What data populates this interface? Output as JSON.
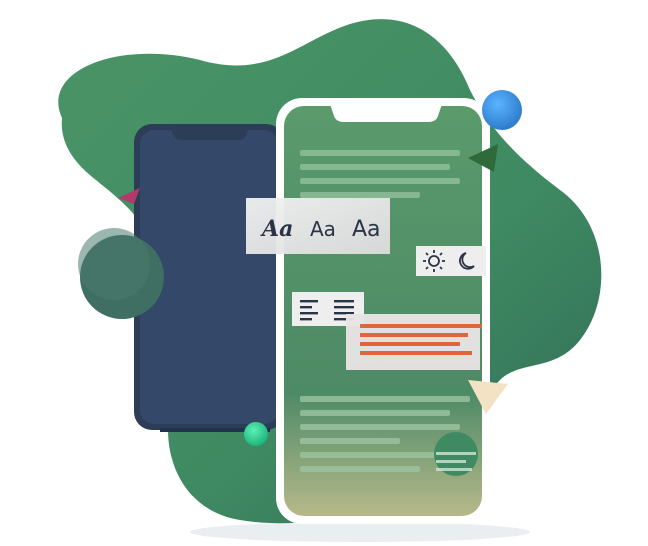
{
  "illustration": {
    "description_free": true,
    "typography_samples": [
      {
        "text": "Aa",
        "style": "bold-italic-serif"
      },
      {
        "text": "Aa",
        "style": "regular-sans"
      },
      {
        "text": "Aa",
        "style": "regular-sans-large"
      }
    ],
    "theme_toggle": {
      "light_icon": "sun-icon",
      "dark_icon": "moon-icon"
    },
    "alignment_icons": [
      "align-left-icon",
      "align-justify-icon"
    ],
    "colors": {
      "blob_green": "#3f8a62",
      "blob_dark": "#2f6a57",
      "phone_back": "#2c3d57",
      "phone_front_frame": "#ffffff",
      "accent_orange": "#e0653f",
      "accent_blue": "#3a8fd9",
      "accent_mint": "#2fd38f",
      "accent_magenta": "#b23a6b",
      "accent_cream": "#f3e2c4"
    }
  }
}
